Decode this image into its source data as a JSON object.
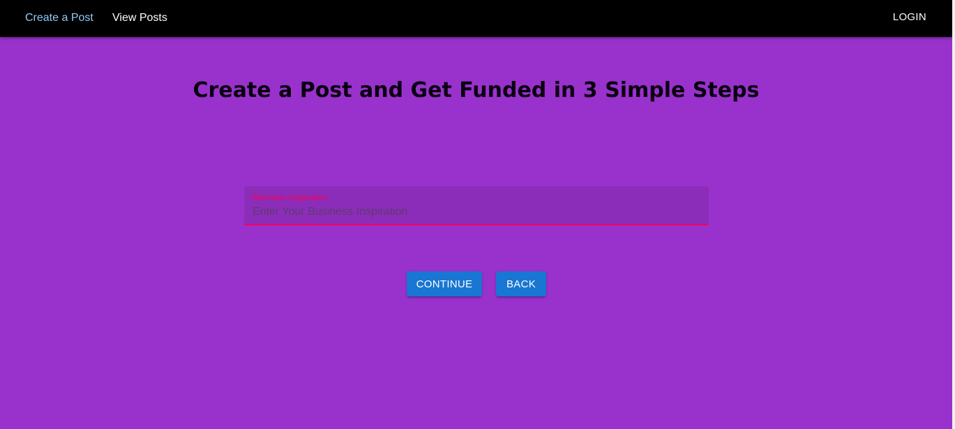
{
  "nav": {
    "links": [
      {
        "label": "Create a Post",
        "active": true
      },
      {
        "label": "View Posts",
        "active": false
      }
    ],
    "login_label": "LOGIN"
  },
  "main": {
    "title": "Create a Post and Get Funded in 3 Simple Steps",
    "field": {
      "label": "Business Inspiration",
      "value": "",
      "placeholder": "Enter Your Business Inspiration"
    },
    "buttons": {
      "continue_label": "CONTINUE",
      "back_label": "BACK"
    }
  },
  "colors": {
    "background": "#9932cc",
    "navbar": "#000000",
    "active_link": "#90caf9",
    "field_accent": "#f50057",
    "button": "#1976d2"
  }
}
